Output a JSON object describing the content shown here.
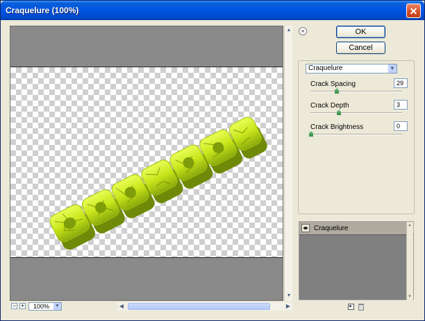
{
  "window": {
    "title": "Craquelure (100%)"
  },
  "toolbar": {
    "ok_label": "OK",
    "cancel_label": "Cancel",
    "collapse_icon": "double-chevron-up-icon"
  },
  "filter": {
    "selected": "Craquelure"
  },
  "params": [
    {
      "label": "Crack Spacing",
      "value": "29",
      "fraction": 0.29
    },
    {
      "label": "Crack Depth",
      "value": "3",
      "fraction": 0.3
    },
    {
      "label": "Crack Brightness",
      "value": "0",
      "fraction": 0.0
    }
  ],
  "zoom": {
    "value": "100%",
    "minus": "−",
    "plus": "+"
  },
  "effect_layers": [
    {
      "name": "Craquelure",
      "visible": true
    }
  ],
  "colors": {
    "accent": "#0054e3",
    "text_art": "#c9e81c",
    "text_art_shadow": "#5f7a05"
  }
}
